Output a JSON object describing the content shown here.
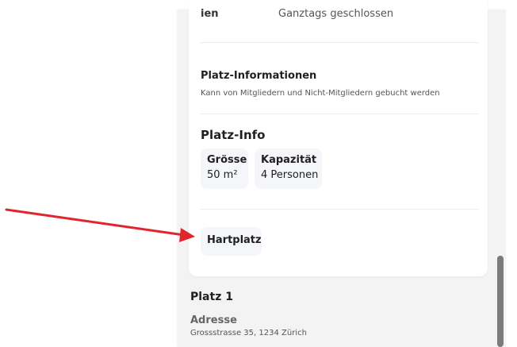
{
  "opening_hours": {
    "day_partial": "ien",
    "status": "Ganztags geschlossen"
  },
  "platz_informationen": {
    "title": "Platz-Informationen",
    "description": "Kann von Mitgliedern und Nicht-Mitgliedern gebucht werden"
  },
  "platz_info": {
    "title": "Platz-Info",
    "tiles": [
      {
        "label": "Grösse",
        "value": "50 m²"
      },
      {
        "label": "Kapazität",
        "value": "4 Personen"
      }
    ]
  },
  "surface_tag": "Hartplatz",
  "next_section": {
    "title": "Platz 1",
    "address_label": "Adresse",
    "address_value": "Grossstrasse 35, 1234 Zürich"
  },
  "colors": {
    "arrow": "#e0252b",
    "panel_bg": "#f3f3f4",
    "tile_bg": "#f5f6f9"
  }
}
